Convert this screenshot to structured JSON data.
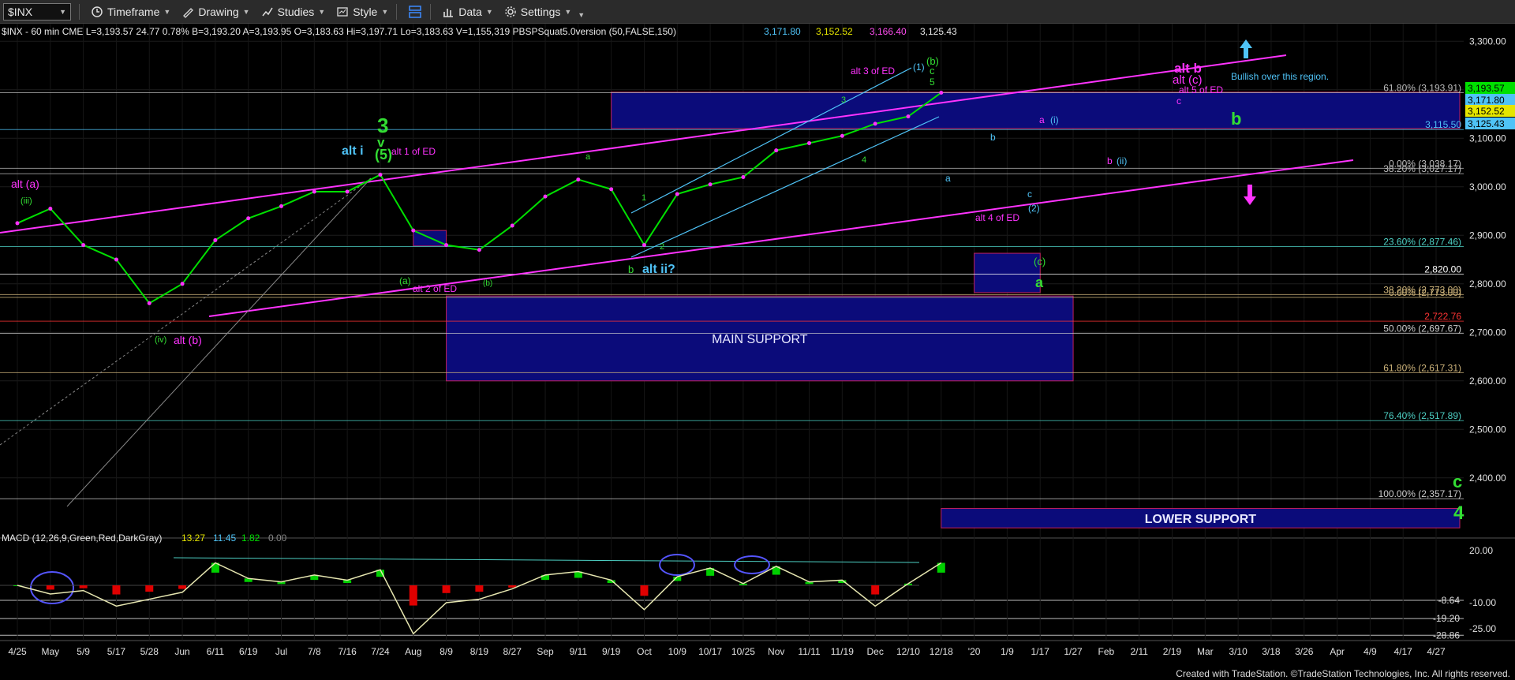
{
  "toolbar": {
    "symbol": "$INX",
    "items": [
      {
        "label": "Timeframe",
        "icon": "clock-icon"
      },
      {
        "label": "Drawing",
        "icon": "pencil-icon"
      },
      {
        "label": "Studies",
        "icon": "studies-icon"
      },
      {
        "label": "Style",
        "icon": "style-icon"
      },
      {
        "label": "",
        "icon": "layout-icon"
      },
      {
        "label": "Data",
        "icon": "bar-chart-icon"
      },
      {
        "label": "Settings",
        "icon": "gear-icon"
      }
    ]
  },
  "info_bar": {
    "main": "$INX - 60 min  CME  L=3,193.57  24.77  0.78%  B=3,193.20  A=3,193.95  O=3,183.63  Hi=3,197.71  Lo=3,183.63  V=1,155,319  PBSPSquat5.0version (50,FALSE,150)",
    "vals": [
      "3,171.80",
      "3,152.52",
      "3,166.40",
      "3,125.43"
    ],
    "colors": [
      "#4fc3f7",
      "#e6e600",
      "#ff4df0",
      "#e8e8e8"
    ]
  },
  "macd_label": {
    "text": "MACD (12,26,9,Green,Red,DarkGray)",
    "vals": [
      "13.27",
      "11.45",
      "1.82",
      "0.00"
    ]
  },
  "footer": "Created with TradeStation. ©TradeStation Technologies, Inc. All rights reserved.",
  "chart_data": {
    "type": "line",
    "title": "$INX - 60 min",
    "price_axis": {
      "ticks": [
        3300,
        3200,
        3100,
        3000,
        2900,
        2800,
        2700,
        2600,
        2500,
        2400
      ],
      "labels": [
        "3,300.00",
        "3,200.00",
        "3,100.00",
        "3,000.00",
        "2,900.00",
        "2,800.00",
        "2,700.00",
        "2,600.00",
        "2,500.00",
        "2,400.00"
      ],
      "range": [
        2320,
        3320
      ]
    },
    "macd_axis": {
      "ticks": [
        20,
        -10,
        -25
      ],
      "labels": [
        "20.00",
        "-10.00",
        "-25.00"
      ],
      "range": [
        -31,
        26
      ]
    },
    "time_axis": [
      "4/25",
      "May",
      "5/9",
      "5/17",
      "5/28",
      "Jun",
      "6/11",
      "6/19",
      "Jul",
      "7/8",
      "7/16",
      "7/24",
      "Aug",
      "8/9",
      "8/19",
      "8/27",
      "Sep",
      "9/11",
      "9/19",
      "Oct",
      "10/9",
      "10/17",
      "10/25",
      "Nov",
      "11/11",
      "11/19",
      "Dec",
      "12/10",
      "12/18",
      "'20",
      "1/9",
      "1/17",
      "1/27",
      "Feb",
      "2/11",
      "2/19",
      "Mar",
      "3/10",
      "3/18",
      "3/26",
      "Apr",
      "4/9",
      "4/17",
      "4/27"
    ],
    "series": [
      {
        "x": [
          "4/25",
          "May",
          "5/9",
          "5/17",
          "5/28",
          "Jun",
          "6/11",
          "6/19",
          "Jul",
          "7/8",
          "7/16",
          "7/24",
          "Aug",
          "8/9",
          "8/19",
          "8/27",
          "Sep",
          "9/11",
          "9/19",
          "Oct",
          "10/9",
          "10/17",
          "10/25",
          "Nov",
          "11/11",
          "11/19",
          "Dec",
          "12/10",
          "12/18"
        ],
        "values": [
          2925,
          2955,
          2880,
          2850,
          2760,
          2800,
          2890,
          2935,
          2960,
          2990,
          2990,
          3025,
          2910,
          2880,
          2870,
          2920,
          2980,
          3015,
          2995,
          2880,
          2985,
          3005,
          3020,
          3075,
          3090,
          3105,
          3130,
          3145,
          3194
        ]
      }
    ],
    "macd_series": {
      "x": [
        "4/25",
        "May",
        "5/9",
        "5/17",
        "5/28",
        "Jun",
        "6/11",
        "6/19",
        "Jul",
        "7/8",
        "7/16",
        "7/24",
        "Aug",
        "8/9",
        "8/19",
        "8/27",
        "Sep",
        "9/11",
        "9/19",
        "Oct",
        "10/9",
        "10/17",
        "10/25",
        "Nov",
        "11/11",
        "11/19",
        "Dec",
        "12/10",
        "12/18"
      ],
      "values": [
        0,
        -5,
        -3,
        -12,
        -8,
        -4,
        13,
        4,
        2,
        6,
        3,
        9,
        -28,
        -10,
        -8,
        -2,
        6,
        8,
        3,
        -14,
        5,
        10,
        1,
        11,
        2,
        3,
        -12,
        1,
        13
      ]
    },
    "price_labels": [
      {
        "text": "3,193.57",
        "color": "#00e000"
      },
      {
        "text": "3,171.80",
        "color": "#4fc3f7"
      },
      {
        "text": "3,152.52",
        "color": "#e6e600"
      },
      {
        "text": "3,125.43",
        "color": "#4fc3f7"
      }
    ],
    "fib_levels": [
      {
        "label": "61.80% (3,193.91)",
        "value": 3194,
        "color": "#bbbbbb"
      },
      {
        "label": "3,115.50",
        "value": 3118,
        "color": "#4fc3f7"
      },
      {
        "label": "0.00% (3,038.17)",
        "value": 3038,
        "color": "#bbbbbb"
      },
      {
        "label": "38.20% (3,027.17)",
        "value": 3027,
        "color": "#bbbbbb"
      },
      {
        "label": "23.60% (2,877.46)",
        "value": 2877,
        "color": "#4dd0c4"
      },
      {
        "label": "2,820.00",
        "value": 2820,
        "color": "#ffffff"
      },
      {
        "label": "38.20% (2,773.00)",
        "value": 2778,
        "color": "#cdb37a"
      },
      {
        "label": "0.00% (2,773.00)",
        "value": 2772,
        "color": "#cdb37a"
      },
      {
        "label": "2,722.76",
        "value": 2723,
        "color": "#ff3333"
      },
      {
        "label": "50.00% (2,697.67)",
        "value": 2698,
        "color": "#cccccc"
      },
      {
        "label": "61.80% (2,617.31)",
        "value": 2617,
        "color": "#cdb37a"
      },
      {
        "label": "76.40% (2,517.89)",
        "value": 2518,
        "color": "#4dd0c4"
      },
      {
        "label": "100.00% (2,357.17)",
        "value": 2357,
        "color": "#cccccc"
      }
    ],
    "macd_levels": [
      {
        "label": "-8.64",
        "value": -8.64
      },
      {
        "label": "-19.20",
        "value": -19.2
      },
      {
        "label": "-28.86",
        "value": -28.86
      }
    ],
    "zones": [
      {
        "label": "",
        "top": 3195,
        "bottom": 3120,
        "from": "9/19",
        "to": "end",
        "color": "#0b0b7a"
      },
      {
        "label": "MAIN SUPPORT",
        "top": 2775,
        "bottom": 2600,
        "from": "8/9",
        "to": "1/27",
        "color": "#0b0b7a"
      },
      {
        "label": "",
        "top": 2863,
        "bottom": 2782,
        "from": "'20",
        "to": "1/17",
        "color": "#0b0b7a"
      },
      {
        "label": "",
        "top": 2910,
        "bottom": 2878,
        "from": "Aug",
        "to": "8/9",
        "color": "#0b0b7a"
      },
      {
        "label": "LOWER SUPPORT",
        "top": 2337,
        "bottom": 2297,
        "from": "12/18",
        "to": "end",
        "color": "#0b0b7a"
      }
    ],
    "annotations": [
      {
        "text": "alt (a)",
        "color": "#ff33ff"
      },
      {
        "text": "(iii)",
        "color": "#33dd33"
      },
      {
        "text": "(iv)",
        "color": "#33dd33"
      },
      {
        "text": "alt (b)",
        "color": "#ff33ff"
      },
      {
        "text": "3",
        "color": "#33dd33"
      },
      {
        "text": "v",
        "color": "#33dd33"
      },
      {
        "text": "(5)",
        "color": "#33dd33"
      },
      {
        "text": "alt i",
        "color": "#4fc3f7"
      },
      {
        "text": "alt 1 of ED",
        "color": "#ff33ff"
      },
      {
        "text": "(a)",
        "color": "#33dd33"
      },
      {
        "text": "alt 2 of ED",
        "color": "#ff33ff"
      },
      {
        "text": "a",
        "color": "#33dd33"
      },
      {
        "text": "(b)",
        "color": "#33dd33"
      },
      {
        "text": "b",
        "color": "#33dd33"
      },
      {
        "text": "alt ii?",
        "color": "#4fc3f7"
      },
      {
        "text": "1",
        "color": "#33dd33"
      },
      {
        "text": "2",
        "color": "#33dd33"
      },
      {
        "text": "3",
        "color": "#33dd33"
      },
      {
        "text": "4",
        "color": "#33dd33"
      },
      {
        "text": "alt 3 of ED",
        "color": "#ff33ff"
      },
      {
        "text": "(1)",
        "color": "#4fc3f7"
      },
      {
        "text": "(b)",
        "color": "#33dd33"
      },
      {
        "text": "c",
        "color": "#33dd33"
      },
      {
        "text": "5",
        "color": "#33dd33"
      },
      {
        "text": "b",
        "color": "#4fc3f7"
      },
      {
        "text": "a",
        "color": "#ff33ff"
      },
      {
        "text": "(i)",
        "color": "#4fc3f7"
      },
      {
        "text": "a",
        "color": "#4fc3f7"
      },
      {
        "text": "b",
        "color": "#ff33ff"
      },
      {
        "text": "(ii)",
        "color": "#4fc3f7"
      },
      {
        "text": "c",
        "color": "#4fc3f7"
      },
      {
        "text": "(2)",
        "color": "#4fc3f7"
      },
      {
        "text": "alt 4 of ED",
        "color": "#ff33ff"
      },
      {
        "text": "(c)",
        "color": "#33dd33"
      },
      {
        "text": "a",
        "color": "#33dd33"
      },
      {
        "text": "alt b",
        "color": "#ff33ff"
      },
      {
        "text": "alt (c)",
        "color": "#ff33ff"
      },
      {
        "text": "alt 5 of ED",
        "color": "#ff33ff"
      },
      {
        "text": "c",
        "color": "#ff33ff"
      },
      {
        "text": "Bullish over this region.",
        "color": "#4fc3f7"
      },
      {
        "text": "b",
        "color": "#33dd33"
      },
      {
        "text": "c",
        "color": "#33dd33"
      },
      {
        "text": "4",
        "color": "#33dd33"
      }
    ]
  }
}
